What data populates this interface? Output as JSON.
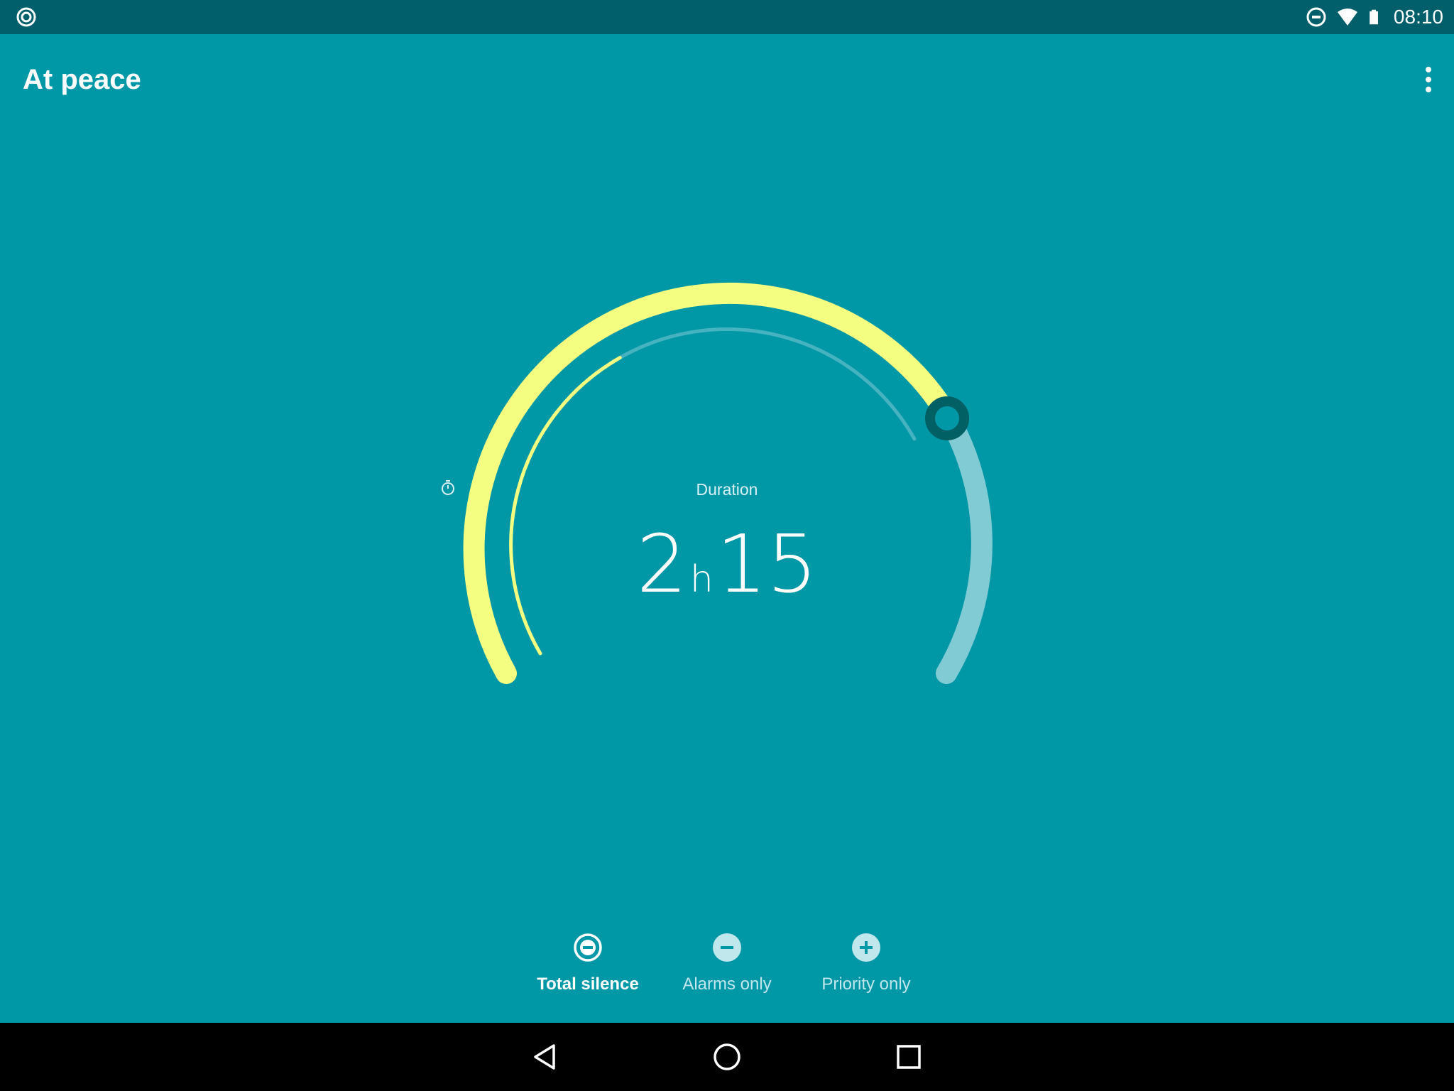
{
  "status_bar": {
    "time": "08:10",
    "left_icon": "notification-ring-icon",
    "icons": [
      "dnd-icon",
      "wifi-icon",
      "battery-icon"
    ]
  },
  "app_bar": {
    "title": "At peace",
    "menu_icon": "overflow-menu-icon"
  },
  "dial": {
    "label": "Duration",
    "label_icon": "timer-icon",
    "hours": "2",
    "hours_unit": "h",
    "minutes": "15",
    "level_fraction": 0.78,
    "colors": {
      "active_arc": "#f4ff81",
      "inactive_arc": "#80cbd4",
      "handle": "#006064",
      "inner_track": "#46b3c0"
    }
  },
  "modes": [
    {
      "label": "Total silence",
      "icon": "minus-circle-outline-icon",
      "active": true
    },
    {
      "label": "Alarms only",
      "icon": "minus-circle-icon",
      "active": false
    },
    {
      "label": "Priority only",
      "icon": "plus-circle-icon",
      "active": false
    }
  ],
  "nav_bar": {
    "buttons": [
      "back-icon",
      "home-icon",
      "recents-icon"
    ]
  },
  "colors": {
    "background": "#0097a7",
    "status_bar": "#005f6b",
    "nav_bar": "#000000"
  }
}
